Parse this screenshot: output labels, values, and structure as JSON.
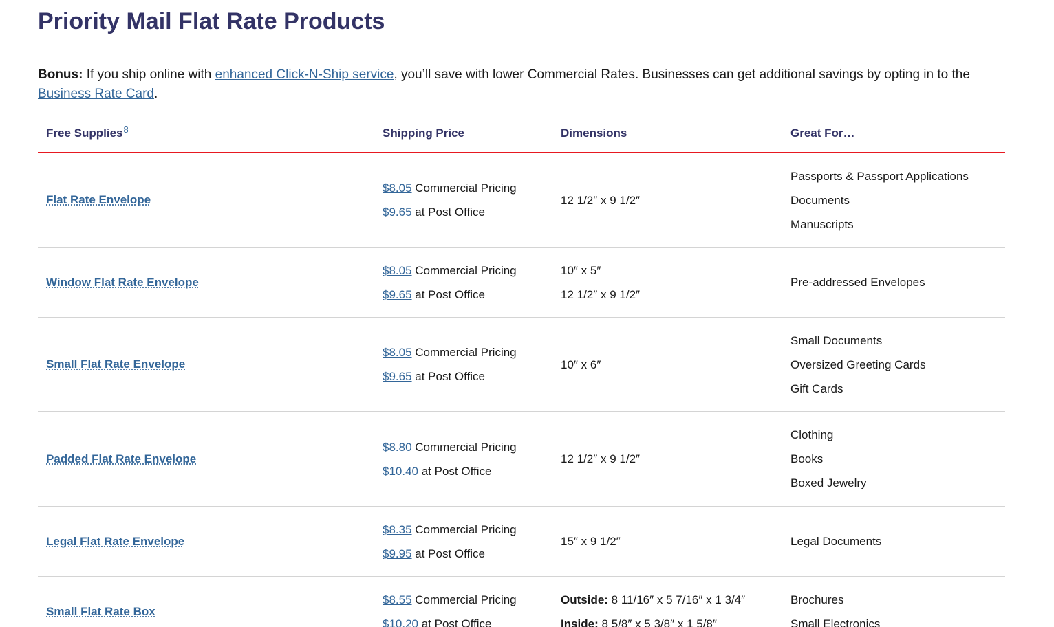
{
  "page_title": "Priority Mail Flat Rate Products",
  "bonus": {
    "label": "Bonus:",
    "text_1": " If you ship online with ",
    "link_1": "enhanced Click-N-Ship service",
    "text_2": ", you’ll save with lower Commercial Rates. Businesses can get additional savings by opting in to the ",
    "link_2": "Business Rate Card",
    "text_3": "."
  },
  "table": {
    "headers": {
      "supplies": "Free Supplies",
      "supplies_footnote": "8",
      "price": "Shipping Price",
      "dimensions": "Dimensions",
      "great_for": "Great For…"
    },
    "rows": [
      {
        "name": "Flat Rate Envelope",
        "commercial_price": "$8.05",
        "commercial_label": " Commercial Pricing",
        "po_price": "$9.65",
        "po_label": " at Post Office",
        "dims": [
          "12 1/2″ x 9 1/2″"
        ],
        "great_for": [
          "Passports & Passport Applications",
          "Documents",
          "Manuscripts"
        ]
      },
      {
        "name": "Window Flat Rate Envelope",
        "commercial_price": "$8.05",
        "commercial_label": " Commercial Pricing",
        "po_price": "$9.65",
        "po_label": " at Post Office",
        "dims": [
          "10″ x 5″",
          "12 1/2″ x 9 1/2″"
        ],
        "great_for": [
          "Pre-addressed Envelopes"
        ]
      },
      {
        "name": "Small Flat Rate Envelope",
        "commercial_price": "$8.05",
        "commercial_label": " Commercial Pricing",
        "po_price": "$9.65",
        "po_label": " at Post Office",
        "dims": [
          "10″ x 6″"
        ],
        "great_for": [
          "Small Documents",
          "Oversized Greeting Cards",
          "Gift Cards"
        ]
      },
      {
        "name": "Padded Flat Rate Envelope",
        "commercial_price": "$8.80",
        "commercial_label": " Commercial Pricing",
        "po_price": "$10.40",
        "po_label": " at Post Office",
        "dims": [
          "12 1/2″ x 9 1/2″"
        ],
        "great_for": [
          "Clothing",
          "Books",
          "Boxed Jewelry"
        ]
      },
      {
        "name": "Legal Flat Rate Envelope",
        "commercial_price": "$8.35",
        "commercial_label": " Commercial Pricing",
        "po_price": "$9.95",
        "po_label": " at Post Office",
        "dims": [
          "15″ x 9 1/2″"
        ],
        "great_for": [
          "Legal Documents"
        ]
      },
      {
        "name": "Small Flat Rate Box",
        "commercial_price": "$8.55",
        "commercial_label": " Commercial Pricing",
        "po_price": "$10.20",
        "po_label": " at Post Office",
        "dims_outside_label": "Outside:",
        "dims_outside": " 8 11/16″ x 5 7/16″ x 1 3/4″",
        "dims_inside_label": "Inside:",
        "dims_inside": " 8 5/8″ x 5 3/8″ x 1 5/8″",
        "great_for": [
          "Brochures",
          "Small Electronics"
        ]
      }
    ]
  }
}
